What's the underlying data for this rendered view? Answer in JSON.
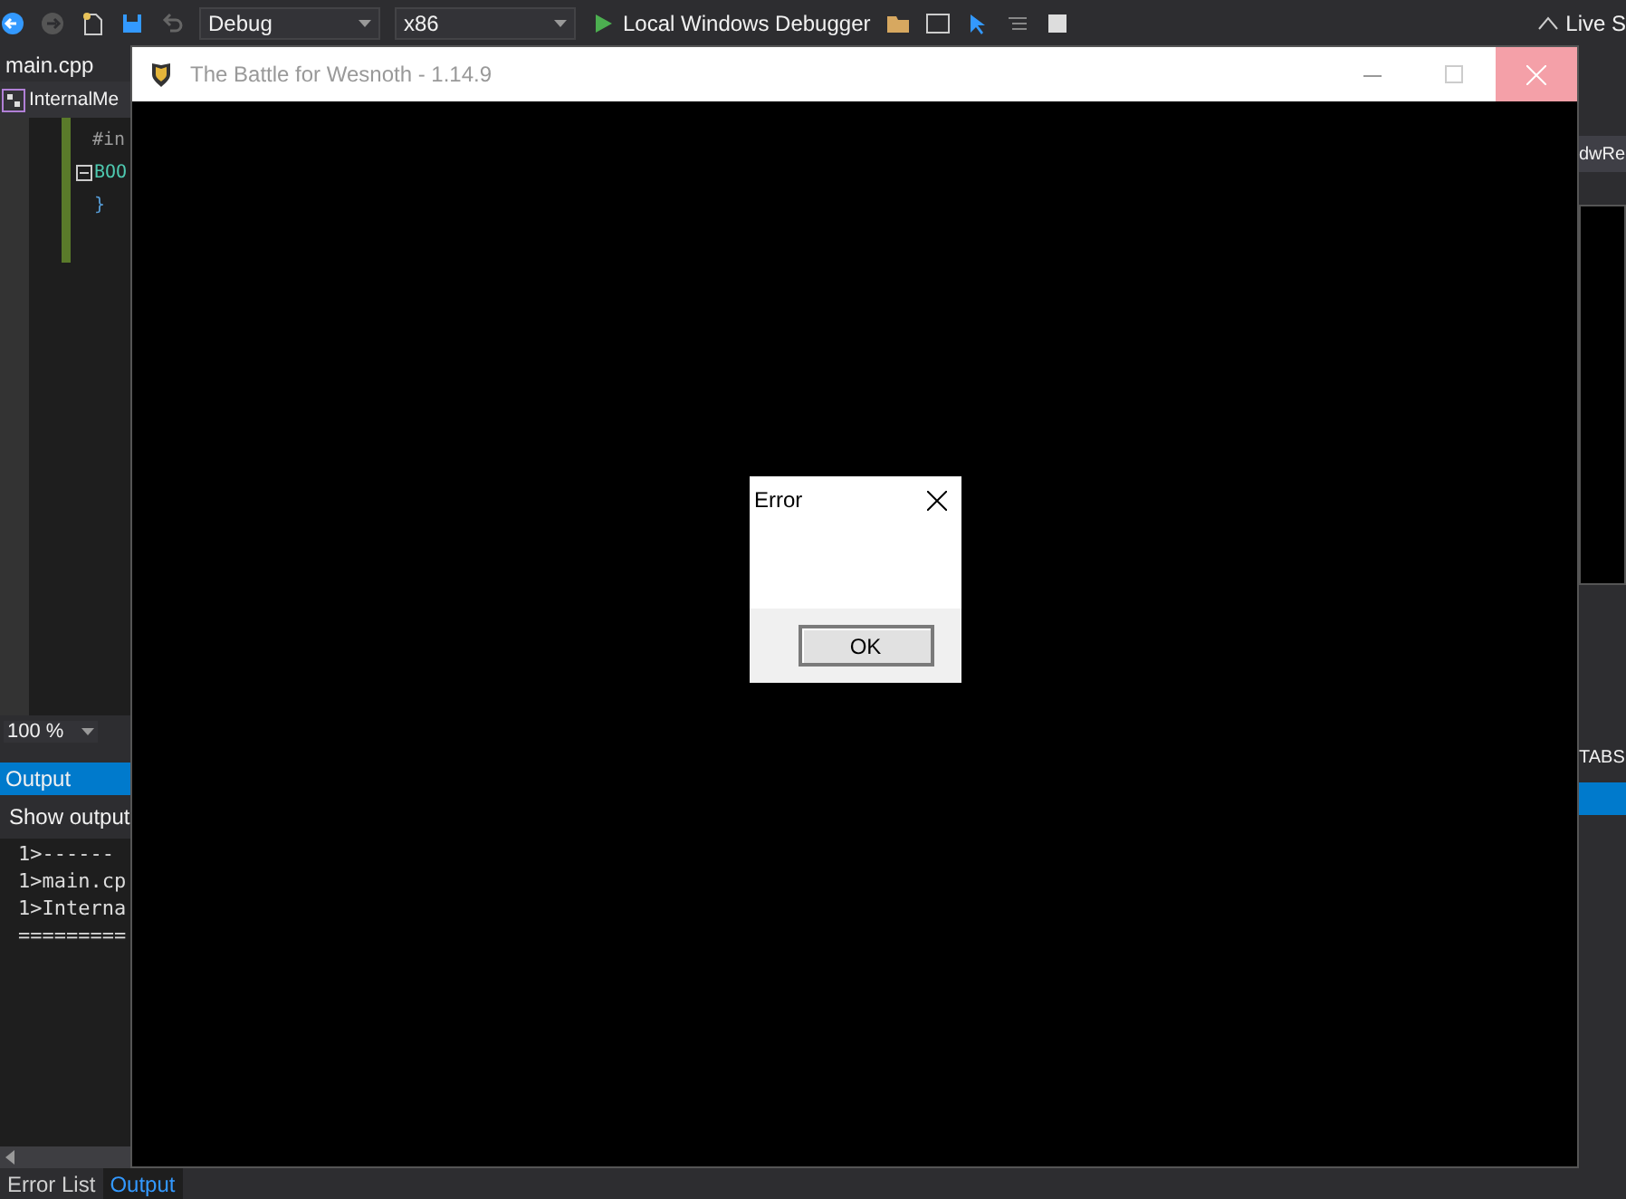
{
  "toolbar": {
    "configuration": "Debug",
    "platform": "x86",
    "debugger": "Local Windows Debugger",
    "live_share": "Live S"
  },
  "editor": {
    "tab": "main.cpp",
    "scope": "InternalMe",
    "zoom": "100 %",
    "lines": [
      {
        "kind": "directive",
        "text": "#in"
      },
      {
        "kind": "declaration",
        "text": "BOO"
      },
      {
        "kind": "brace",
        "text": "}"
      }
    ]
  },
  "right_pane": {
    "tab": "dwRe",
    "status": "TABS"
  },
  "output": {
    "title": "Output",
    "source_label": "Show output",
    "lines": [
      "1>------",
      "1>main.cp",
      "1>Interna",
      "========="
    ]
  },
  "bottom_tabs": [
    {
      "label": "Error List",
      "selected": false
    },
    {
      "label": "Output",
      "selected": true
    }
  ],
  "game_window": {
    "title": "The Battle for Wesnoth - 1.14.9",
    "dialog": {
      "title": "Error",
      "button": "OK"
    }
  }
}
